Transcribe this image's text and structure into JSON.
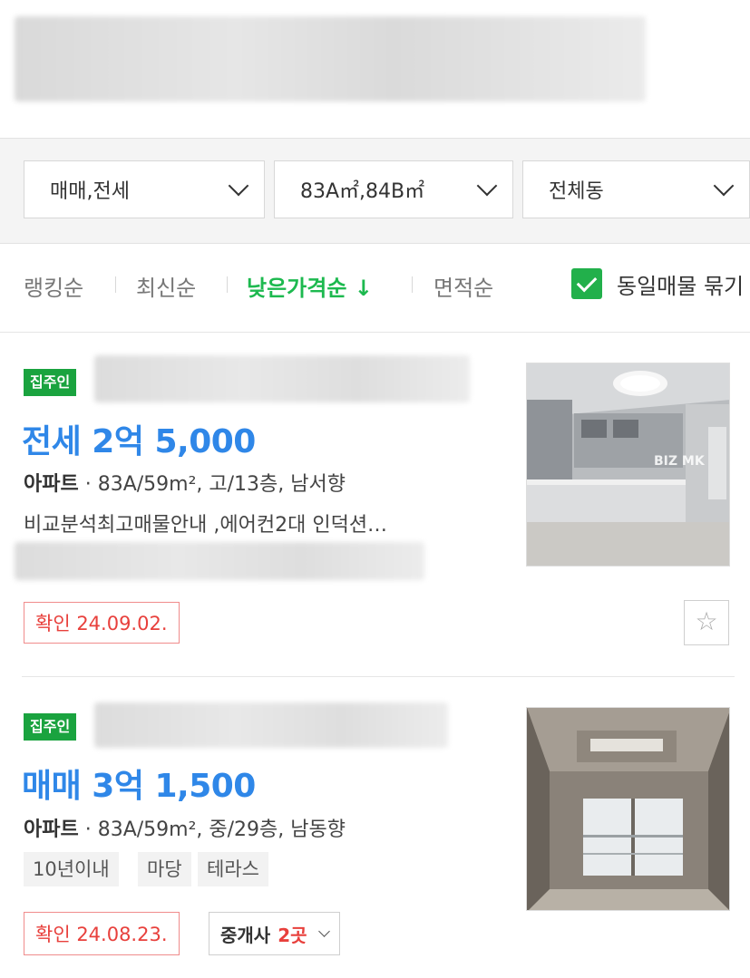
{
  "filters": {
    "trade_type": "매매,전세",
    "area": "83A㎡,84B㎡",
    "dong": "전체동"
  },
  "sort": {
    "ranking": "랭킹순",
    "latest": "최신순",
    "low_price": "낮은가격순",
    "low_price_arrow": "↓",
    "area": "면적순",
    "same_listing_label": "동일매물 묶기",
    "same_listing_checked": true
  },
  "listings": [
    {
      "badge": "집주인",
      "price": "전세 2억 5,000",
      "type": "아파트",
      "spec": "83A/59m², 고/13층, 남서향",
      "description": "비교분석최고매물안내 ,에어컨2대 인덕션…",
      "confirm": "확인 24.09.02.",
      "photo_watermark": "BIZ MK"
    },
    {
      "badge": "집주인",
      "price": "매매 3억 1,500",
      "type": "아파트",
      "spec": "83A/59m², 중/29층, 남동향",
      "tags": [
        "10년이내",
        "마당",
        "테라스"
      ],
      "confirm": "확인 24.08.23.",
      "broker_prefix": "중개사",
      "broker_count": "2곳"
    }
  ],
  "colors": {
    "accent_green": "#1db94f",
    "price_blue": "#2f87e8",
    "confirm_red": "#e8403c"
  },
  "icons": {
    "favorite": "star-outline-icon",
    "dropdown": "chevron-down-icon",
    "checkbox": "check-icon"
  }
}
